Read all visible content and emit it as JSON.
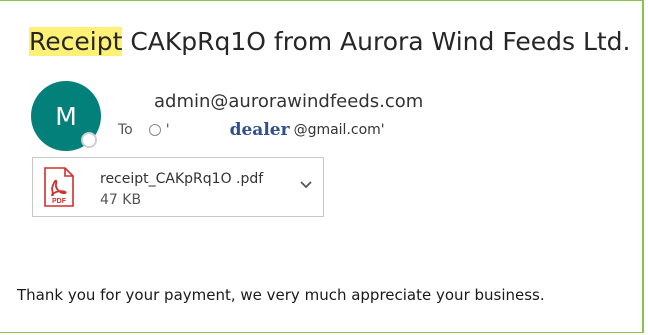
{
  "email": {
    "subject_highlight": "Receipt",
    "subject_rest": " CAKpRq1O from Aurora Wind Feeds Ltd.",
    "sender_initial": "M",
    "sender_email": "admin@aurorawindfeeds.com",
    "to_label": "To",
    "recipient_quote": "'",
    "recipient_name": "dealer",
    "recipient_domain": "@gmail.com'",
    "body": "Thank you for your payment, we very much appreciate your business."
  },
  "attachment": {
    "filename": "receipt_CAKpRq1O  .pdf",
    "size": "47 KB",
    "icon_label": "PDF"
  },
  "colors": {
    "highlight": "#fff176",
    "avatar": "#03807a",
    "frame_border": "#8bc34a",
    "pdf_red": "#d32f2f"
  }
}
